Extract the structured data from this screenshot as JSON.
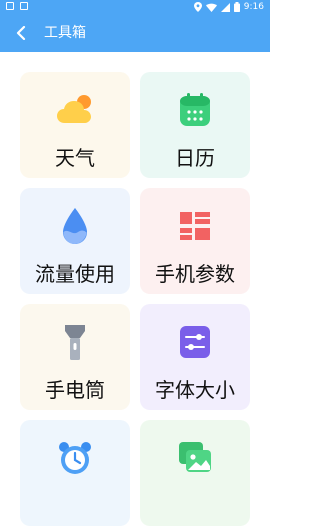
{
  "status_bar": {
    "time": "9:16",
    "icons": [
      "location-icon",
      "wifi-icon",
      "signal-icon",
      "battery-icon"
    ]
  },
  "app_bar": {
    "title": "工具箱",
    "back_icon": "back-arrow-icon"
  },
  "colors": {
    "primary": "#4da6f5",
    "text": "#111111"
  },
  "tools": [
    {
      "label": "天气",
      "icon": "weather-cloud-sun-icon"
    },
    {
      "label": "日历",
      "icon": "calendar-icon"
    },
    {
      "label": "流量使用",
      "icon": "water-drop-icon"
    },
    {
      "label": "手机参数",
      "icon": "grid-tiles-icon"
    },
    {
      "label": "手电筒",
      "icon": "flashlight-icon"
    },
    {
      "label": "字体大小",
      "icon": "sliders-icon"
    },
    {
      "label": "",
      "icon": "alarm-clock-icon"
    },
    {
      "label": "",
      "icon": "image-gallery-icon"
    }
  ]
}
